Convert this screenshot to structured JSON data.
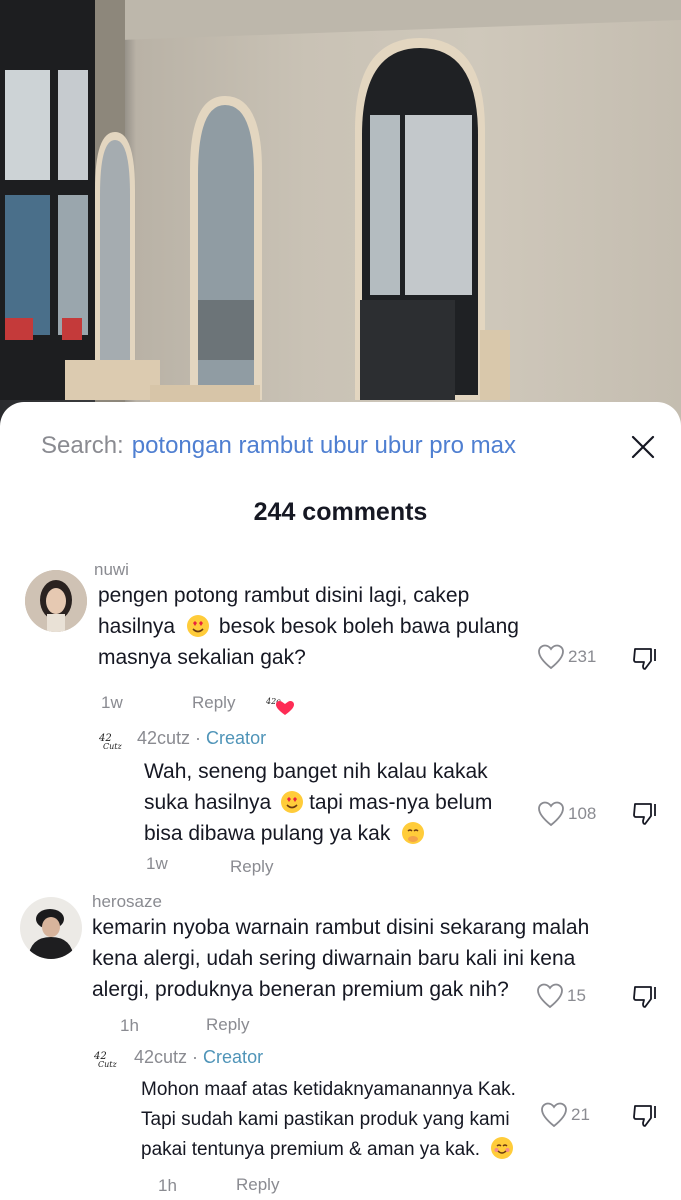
{
  "search": {
    "label": "Search:",
    "query": "potongan rambut ubur ubur pro max"
  },
  "comments_count": "244 comments",
  "comments": [
    {
      "user": "nuwi",
      "lines": [
        "pengen potong rambut disini lagi, cakep",
        "hasilnya",
        "besok besok boleh bawa pulang",
        "masnya sekalian gak?"
      ],
      "likes": "231",
      "time": "1w",
      "reply_label": "Reply",
      "creator_liked": true,
      "reply": {
        "user": "42cutz",
        "separator": " · ",
        "badge": "Creator",
        "lines": [
          "Wah, seneng banget nih kalau kakak",
          "suka hasilnya",
          "tapi mas-nya belum",
          "bisa dibawa pulang ya kak"
        ],
        "likes": "108",
        "time": "1w",
        "reply_label": "Reply"
      }
    },
    {
      "user": "herosaze",
      "lines": [
        "kemarin nyoba warnain rambut disini sekarang malah",
        "kena alergi, udah sering diwarnain baru kali ini kena",
        "alergi, produknya beneran premium gak nih?"
      ],
      "likes": "15",
      "time": "1h",
      "reply_label": "Reply",
      "reply": {
        "user": "42cutz",
        "separator": " · ",
        "badge": "Creator",
        "lines": [
          "Mohon maaf atas ketidaknyamanannya Kak.",
          "Tapi sudah kami pastikan produk yang kami",
          "pakai tentunya premium & aman ya kak."
        ],
        "likes": "21",
        "time": "1h",
        "reply_label": "Reply"
      }
    }
  ],
  "colors": {
    "accent": "#4f7fd1",
    "creator": "#4f94b8",
    "muted": "#8a8b91",
    "heart": "#fe2c55"
  }
}
